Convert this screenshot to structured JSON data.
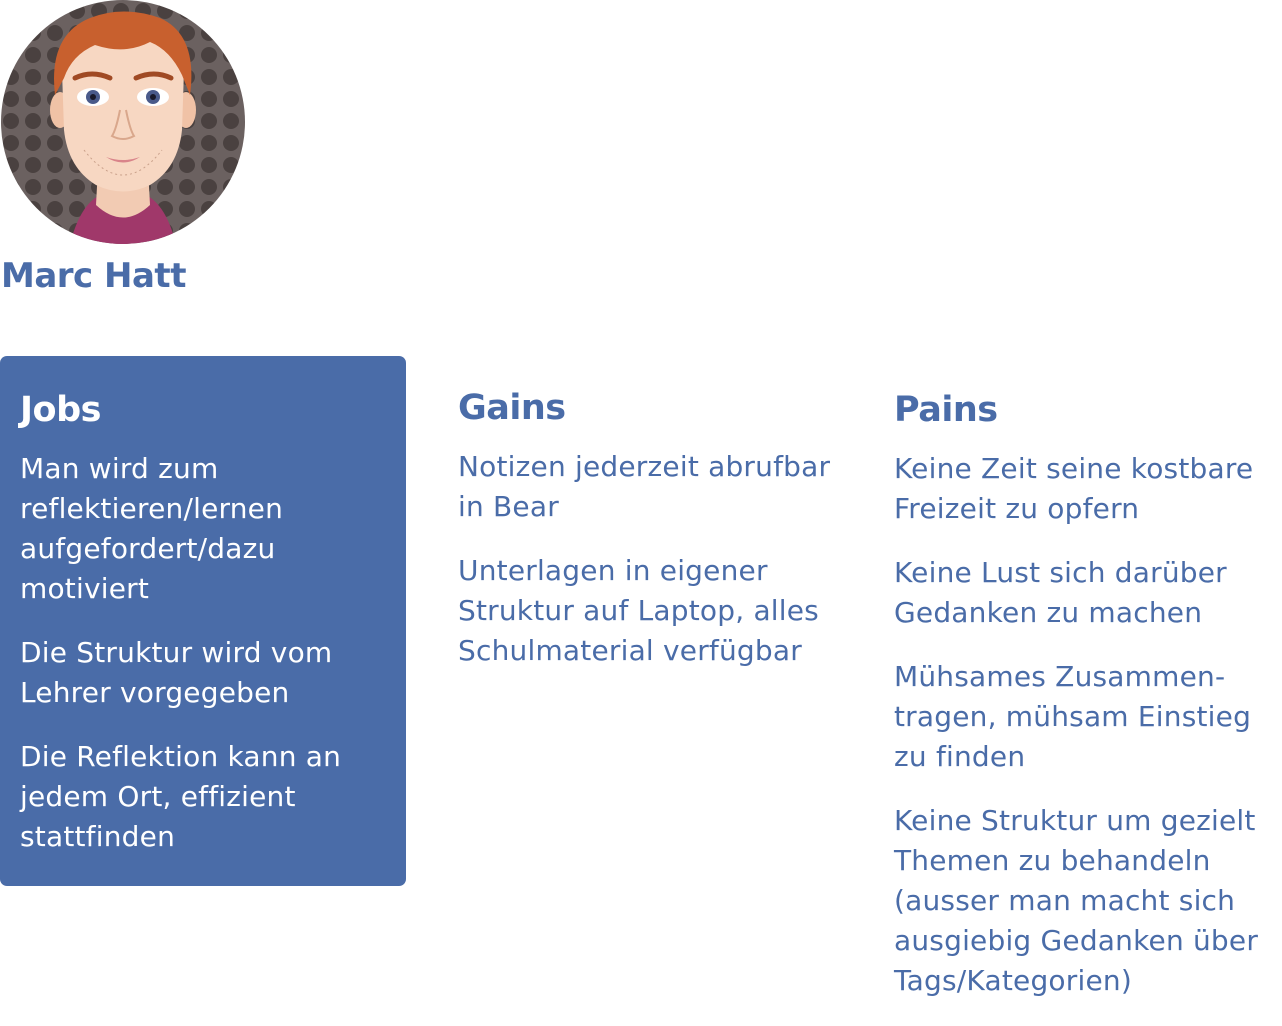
{
  "persona": {
    "name": "Marc Hatt"
  },
  "columns": {
    "jobs": {
      "title": "Jobs",
      "items": [
        "Man wird zum reflektieren/lernen aufgefordert/dazu motiviert",
        "Die Struktur wird vom Lehrer vorgegeben",
        "Die Reflektion kann an jedem Ort, effizient stattfinden"
      ]
    },
    "gains": {
      "title": "Gains",
      "items": [
        "Notizen jederzeit abrufbar in Bear",
        "Unterlagen in eigener Struktur auf Laptop, alles Schulmaterial verfügbar"
      ]
    },
    "pains": {
      "title": "Pains",
      "items": [
        "Keine Zeit seine kostbare Freizeit zu opfern",
        "Keine Lust sich darüber Gedanken zu machen",
        "Mühsames Zusammen-tragen, mühsam Einstieg zu finden",
        "Keine Struktur um gezielt Themen zu behandeln (ausser man macht sich ausgiebig Gedanken über Tags/Kategorien)"
      ]
    }
  },
  "colors": {
    "accent": "#4a6ca8",
    "background": "#ffffff",
    "card_text": "#ffffff"
  }
}
